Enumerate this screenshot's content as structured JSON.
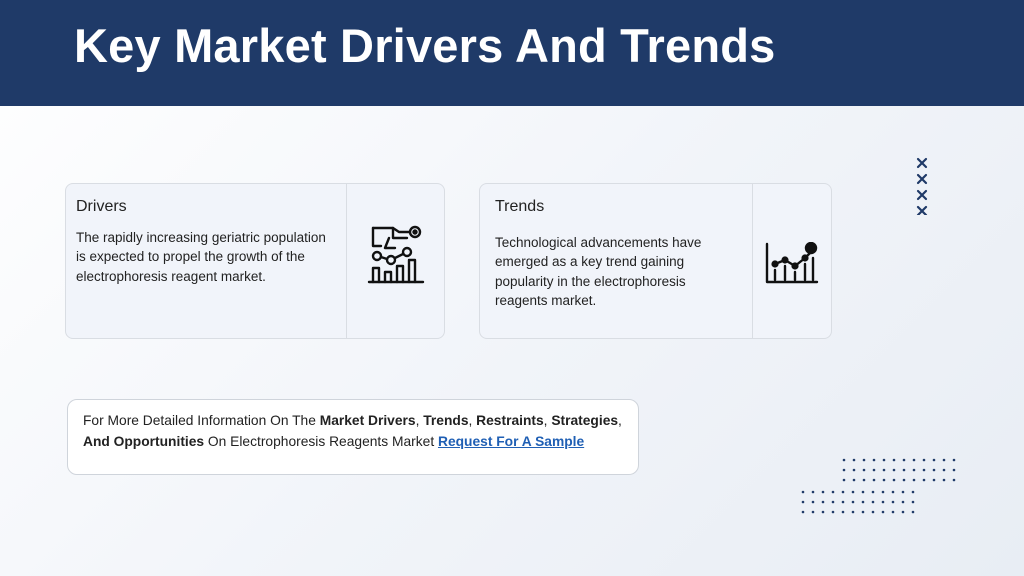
{
  "header": {
    "title": "Key Market Drivers And Trends"
  },
  "colors": {
    "header_bg": "#1f3a68",
    "link": "#1f5fb4",
    "card_bg": "#f1f4fa",
    "decor": "#1f3a68"
  },
  "cards": [
    {
      "heading": "Drivers",
      "text": "The rapidly increasing geriatric population is expected to propel the growth of the electrophoresis reagent market.",
      "icon": "hand-chart-icon"
    },
    {
      "heading": "Trends",
      "text": "Technological advancements have emerged as a key trend gaining popularity in the electrophoresis reagents market.",
      "icon": "trend-chart-icon"
    }
  ],
  "info": {
    "t1": "For More Detailed Information On The ",
    "b1": "Market Drivers",
    "t2": ", ",
    "b2": "Trends",
    "t3": ", ",
    "b3": "Restraints",
    "t4": ", ",
    "b4": "Strategies",
    "t5": ", ",
    "b5": "And Opportunities",
    "t6": " On Electrophoresis Reagents Market  ",
    "link": "Request For A Sample"
  }
}
